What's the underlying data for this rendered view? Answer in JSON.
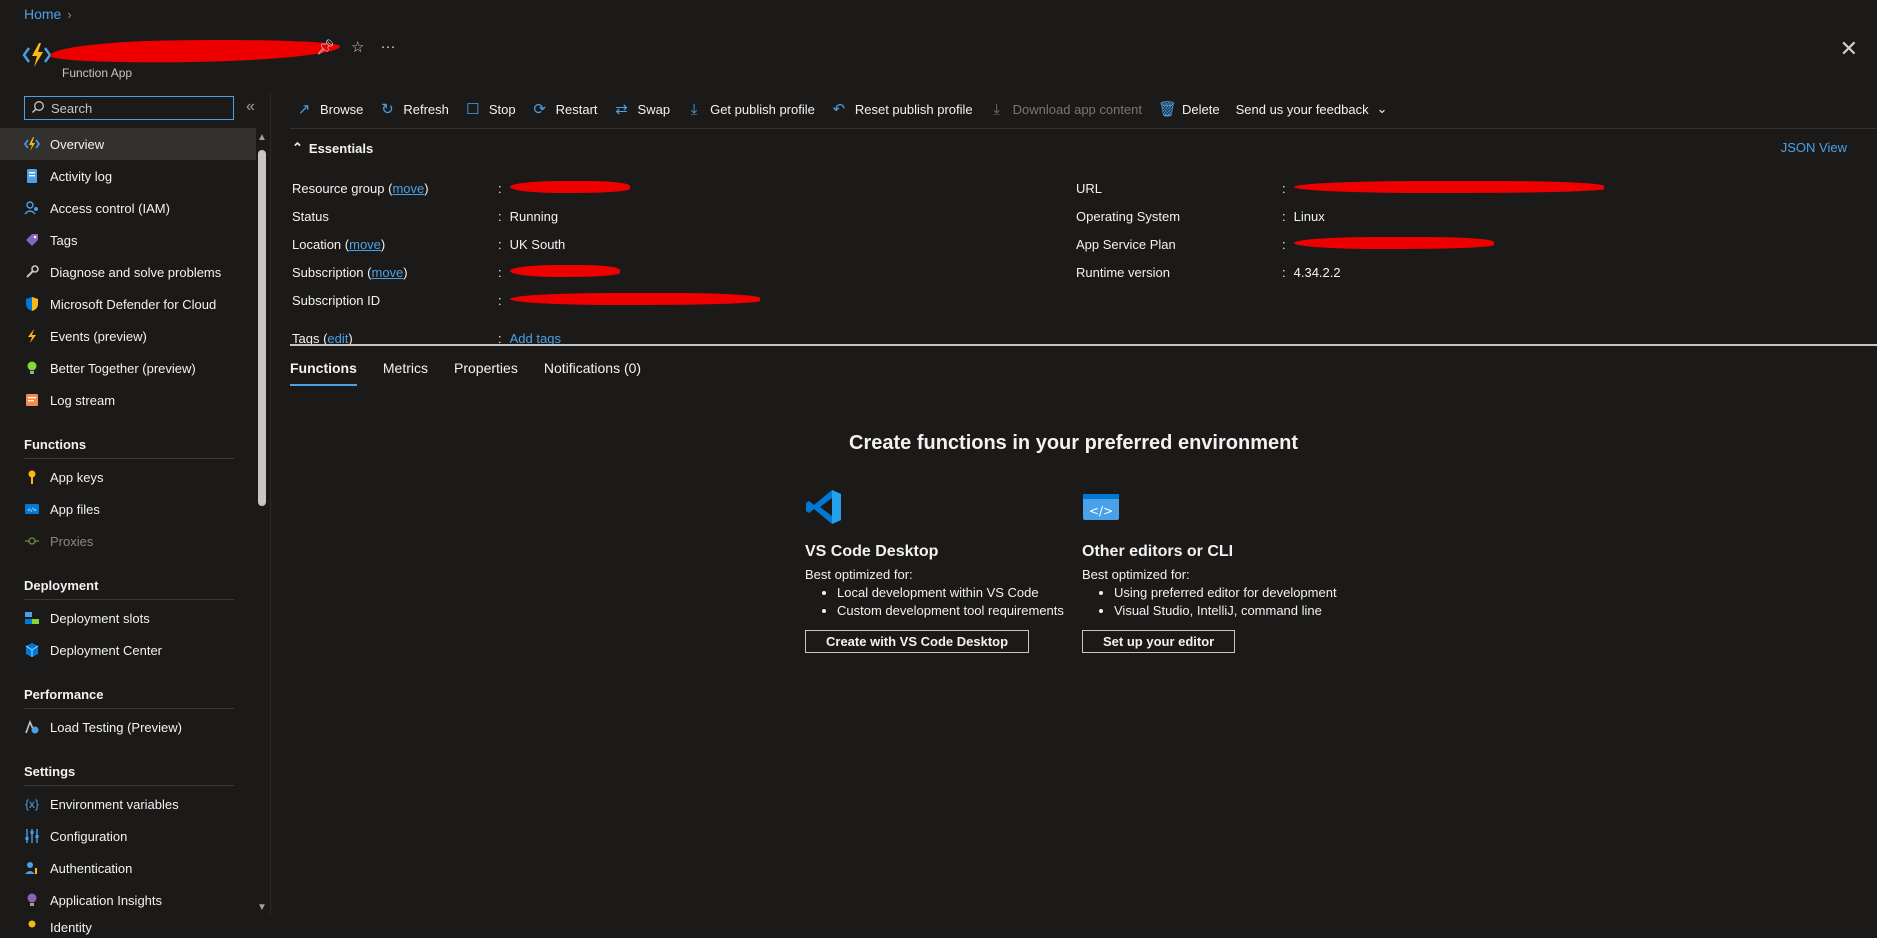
{
  "breadcrumb": {
    "home": "Home"
  },
  "header": {
    "title": "",
    "subtitle": "Function App",
    "more": "···"
  },
  "sidebar": {
    "search_placeholder": "Search",
    "items_top": [
      {
        "label": "Overview",
        "icon": "function-app-icon"
      },
      {
        "label": "Activity log",
        "icon": "activity-log-icon"
      },
      {
        "label": "Access control (IAM)",
        "icon": "iam-icon"
      },
      {
        "label": "Tags",
        "icon": "tag-icon"
      },
      {
        "label": "Diagnose and solve problems",
        "icon": "wrench-icon"
      },
      {
        "label": "Microsoft Defender for Cloud",
        "icon": "shield-icon"
      },
      {
        "label": "Events (preview)",
        "icon": "lightning-icon"
      },
      {
        "label": "Better Together (preview)",
        "icon": "lightbulb-icon"
      },
      {
        "label": "Log stream",
        "icon": "log-stream-icon"
      }
    ],
    "groups": {
      "functions": "Functions",
      "deployment": "Deployment",
      "performance": "Performance",
      "settings": "Settings"
    },
    "functions_items": [
      "App keys",
      "App files",
      "Proxies"
    ],
    "deployment_items": [
      "Deployment slots",
      "Deployment Center"
    ],
    "performance_items": [
      "Load Testing (Preview)"
    ],
    "settings_items": [
      "Environment variables",
      "Configuration",
      "Authentication",
      "Application Insights",
      "Identity"
    ]
  },
  "toolbar": {
    "browse": "Browse",
    "refresh": "Refresh",
    "stop": "Stop",
    "restart": "Restart",
    "swap": "Swap",
    "get_publish_profile": "Get publish profile",
    "reset_publish_profile": "Reset publish profile",
    "download_app_content": "Download app content",
    "delete": "Delete",
    "feedback": "Send us your feedback"
  },
  "essentials": {
    "heading": "Essentials",
    "json_view": "JSON View",
    "left": {
      "resource_group": "Resource group",
      "move": "move",
      "status": "Status",
      "status_value": "Running",
      "location": "Location",
      "location_value": "UK South",
      "subscription": "Subscription",
      "subscription_id": "Subscription ID",
      "tags": "Tags",
      "edit": "edit",
      "add_tags": "Add tags"
    },
    "right": {
      "url": "URL",
      "os": "Operating System",
      "os_value": "Linux",
      "plan": "App Service Plan",
      "runtime": "Runtime version",
      "runtime_value": "4.34.2.2"
    },
    "colon": ":"
  },
  "tabs": [
    "Functions",
    "Metrics",
    "Properties",
    "Notifications (0)"
  ],
  "create": {
    "title": "Create functions in your preferred environment",
    "vscode": {
      "title": "VS Code Desktop",
      "sub": "Best optimized for:",
      "bullets": [
        "Local development within VS Code",
        "Custom development tool requirements"
      ],
      "button": "Create with VS Code Desktop"
    },
    "other": {
      "title": "Other editors or CLI",
      "sub": "Best optimized for:",
      "bullets": [
        "Using preferred editor for development",
        "Visual Studio, IntelliJ, command line"
      ],
      "button": "Set up your editor"
    }
  },
  "colors": {
    "accent": "#4aa1e8",
    "background": "#1b1a19",
    "redaction": "#ee0000"
  }
}
